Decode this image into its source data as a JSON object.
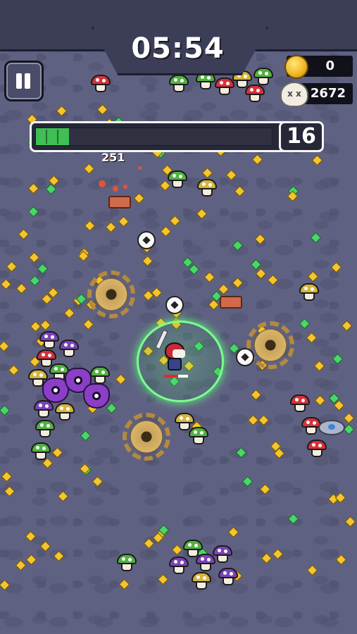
{
  "hud": {
    "timer": "05:54",
    "coins": "0",
    "kills": "2672",
    "level": "16",
    "xp_progress": 0.14
  },
  "effects": {
    "damage_number": "251"
  },
  "player": {
    "health_fraction": 0.6
  },
  "icons": {
    "pause": "pause-icon",
    "coin": "coin-icon",
    "kills": "skull-icon"
  },
  "colors": {
    "xp_fill": "#3fbf54",
    "aura": "#7dff91",
    "background": "#5f6182"
  }
}
